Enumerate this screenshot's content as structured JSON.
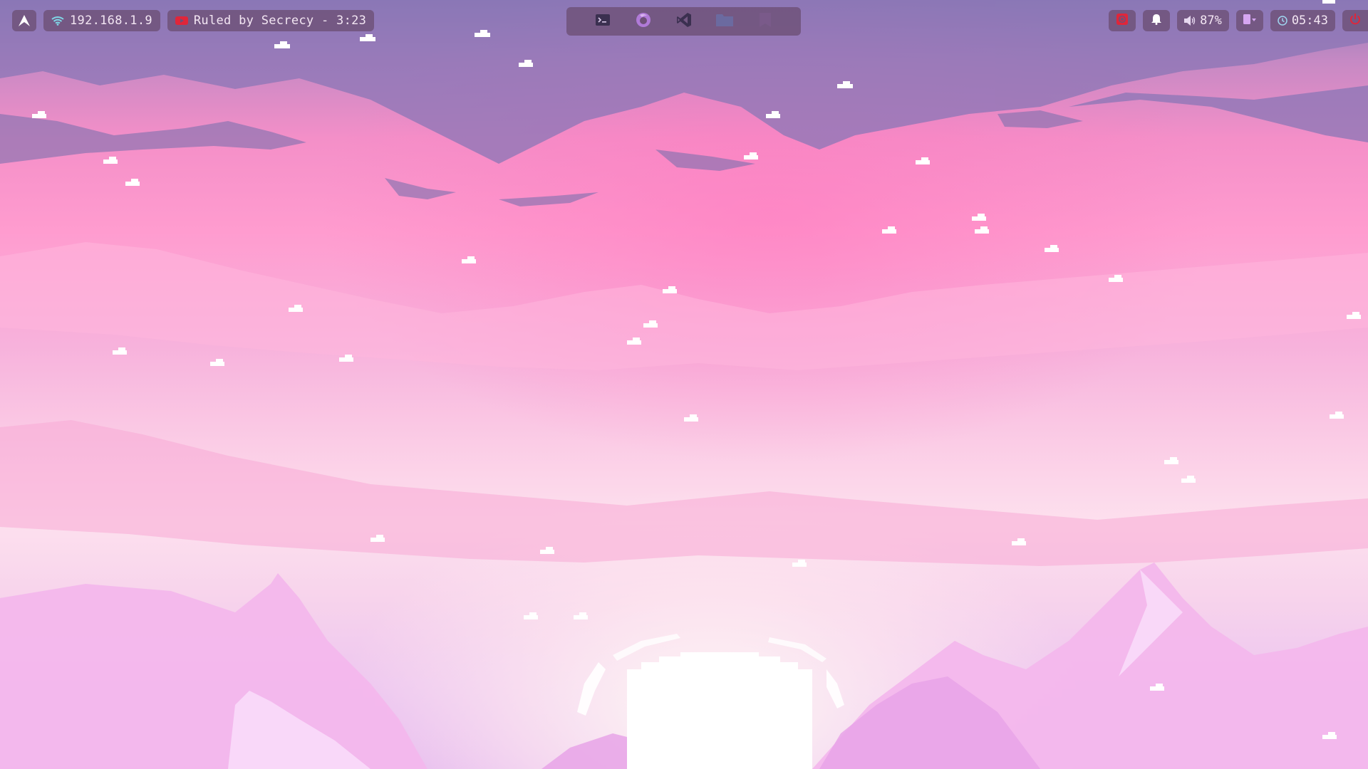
{
  "topbar": {
    "left": {
      "launcher_icon": "arch-logo-icon",
      "network": {
        "icon": "wifi-icon",
        "ip": "192.168.1.9"
      },
      "media": {
        "icon": "youtube-icon",
        "now_playing": "Ruled by Secrecy - 3:23"
      }
    },
    "center": {
      "apps": [
        {
          "name": "terminal",
          "icon": "terminal-icon"
        },
        {
          "name": "firefox",
          "icon": "firefox-icon"
        },
        {
          "name": "vscode",
          "icon": "vscode-icon"
        },
        {
          "name": "files",
          "icon": "folder-icon"
        },
        {
          "name": "notes",
          "icon": "bookmark-icon"
        }
      ]
    },
    "right": {
      "record_icon": "record-icon",
      "notification_icon": "bell-icon",
      "volume": {
        "icon": "speaker-icon",
        "value": "87%"
      },
      "battery_icon": "battery-icon",
      "clock": {
        "icon": "clock-icon",
        "time": "05:43"
      },
      "power_icon": "power-icon"
    }
  },
  "colors": {
    "bar_bg": "#6e5078",
    "accent_red": "#e0263a",
    "launcher_icon_tint": "#3b3050",
    "firefox_tint": "#b07ad8",
    "folder_tint": "#6b6aa0"
  },
  "wallpaper": {
    "description_visible": false
  }
}
